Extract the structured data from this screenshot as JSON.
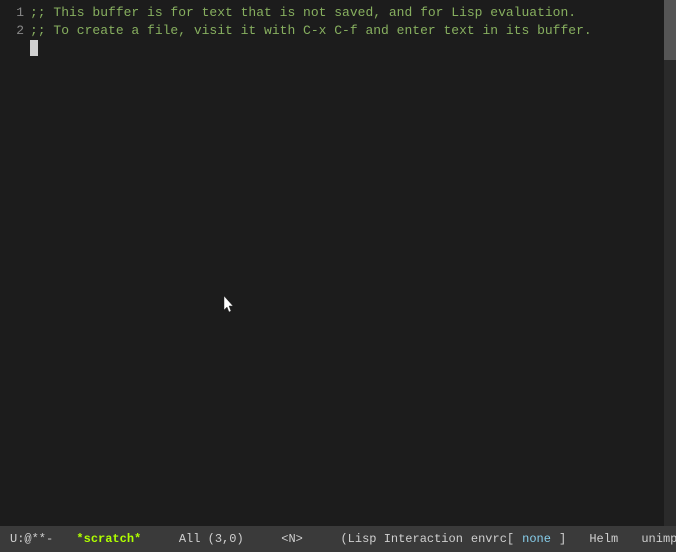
{
  "editor": {
    "background": "#1c1c1c",
    "lines": [
      {
        "number": "1",
        "text": ";; This buffer is for text that is not saved, and for Lisp evaluation."
      },
      {
        "number": "2",
        "text": ";; To create a file, visit it with C-x C-f and enter text in its buffer."
      }
    ],
    "cursor_line": 3,
    "cursor_col": 1
  },
  "status_bar": {
    "ug": "U:@**-",
    "buffer": "*scratch*",
    "position": "All (3,0)",
    "narrow": "<N>",
    "mode": "(Lisp Interaction",
    "env": "envrc[",
    "env_value": "none",
    "env_close": "]",
    "helm": "Helm",
    "unimp": "unimp"
  }
}
